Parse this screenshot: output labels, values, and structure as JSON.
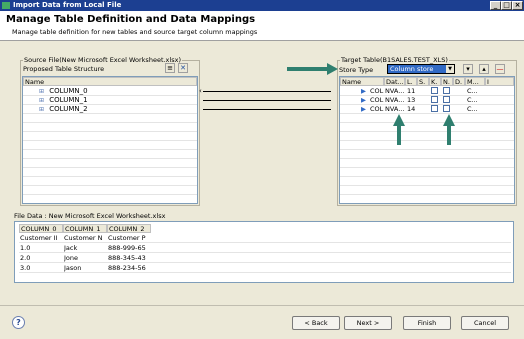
{
  "window": {
    "title": "Import Data from Local File"
  },
  "header": {
    "title": "Manage Table Definition and Data Mappings",
    "subtitle": "Manage table definition for new tables and source target column mappings"
  },
  "source": {
    "group_label": "Source File(New Microsoft Excel Worksheet.xlsx)",
    "toolbar_label": "Proposed Table Structure",
    "column_header": "Name",
    "columns": [
      "COLUMN_0",
      "COLUMN_1",
      "COLUMN_2"
    ]
  },
  "target": {
    "group_label": "Target Table(B1SALES.TEST_XLS)",
    "store_type_label": "Store Type",
    "store_type_value": "Column store",
    "headers": [
      "Name",
      "Dat...",
      "L.",
      "S.",
      "K.",
      "N.",
      "D.",
      "M...",
      "I"
    ],
    "rows": [
      {
        "name": "COL",
        "type": "NVA...",
        "length": "11",
        "comment": "C..."
      },
      {
        "name": "COL",
        "type": "NVA...",
        "length": "13",
        "comment": "C..."
      },
      {
        "name": "COL",
        "type": "NVA...",
        "length": "14",
        "comment": "C..."
      }
    ]
  },
  "file_data": {
    "label": "File Data : New Microsoft Excel Worksheet.xlsx",
    "headers": [
      "COLUMN_0",
      "COLUMN_1",
      "COLUMN_2"
    ],
    "rows": [
      [
        "Customer II",
        "Customer N",
        "Customer P"
      ],
      [
        "1.0",
        "Jack",
        "888-999-65"
      ],
      [
        "2.0",
        "Jone",
        "888-345-43"
      ],
      [
        "3.0",
        "Jason",
        "888-234-56"
      ]
    ]
  },
  "buttons": {
    "back": "< Back",
    "next": "Next >",
    "finish": "Finish",
    "cancel": "Cancel",
    "help": "?"
  },
  "colors": {
    "titlebar": "#1c3f91",
    "annotation_arrow": "#2f7f6f",
    "selection": "#316ac5"
  }
}
